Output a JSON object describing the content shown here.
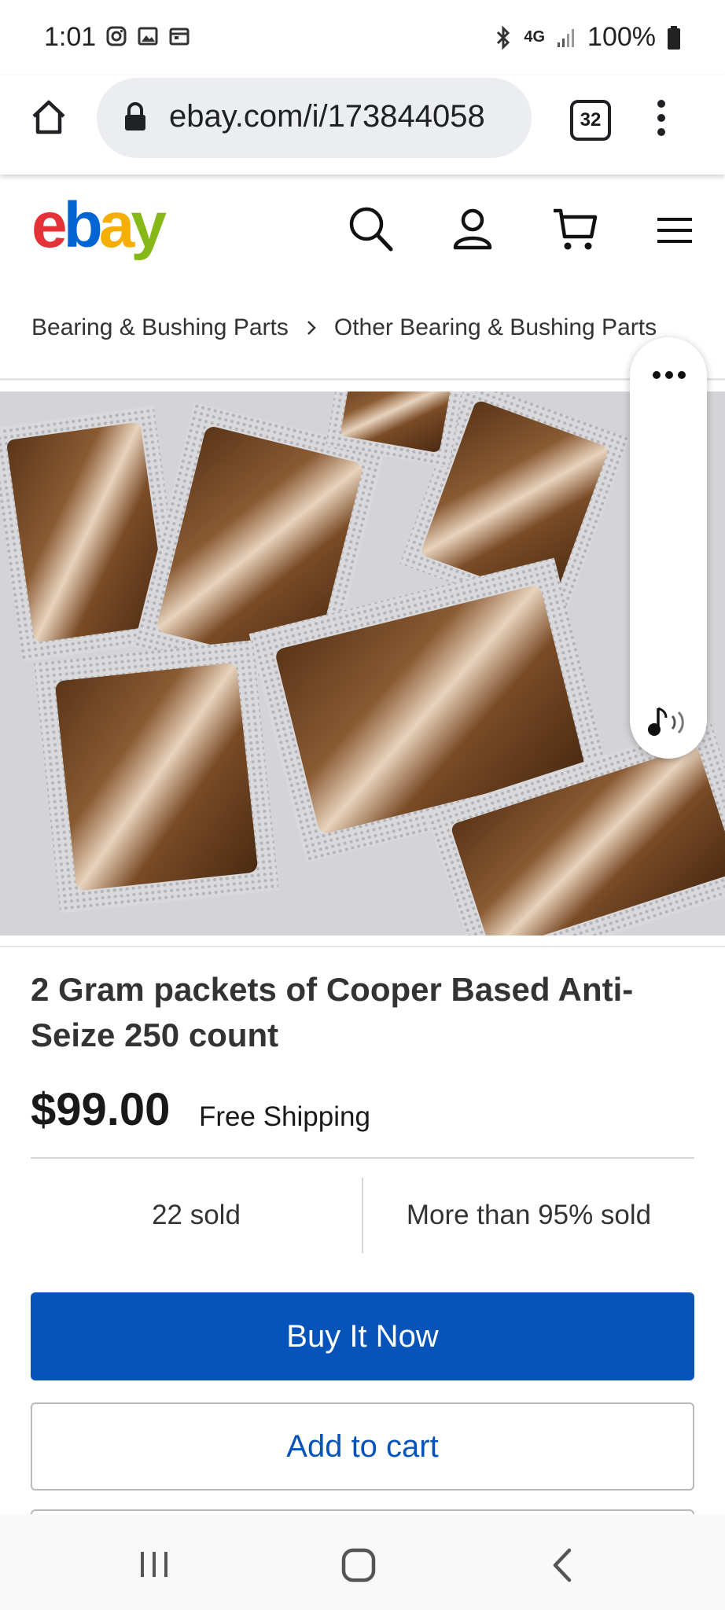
{
  "status_bar": {
    "time": "1:01",
    "network": "4G",
    "battery": "100%",
    "icons": [
      "instagram-icon",
      "gallery-icon",
      "calendar-icon",
      "bluetooth-icon",
      "signal-icon",
      "battery-icon"
    ]
  },
  "browser": {
    "url": "ebay.com/i/173844058",
    "tab_count": "32",
    "icons": [
      "home-icon",
      "lock-icon",
      "tab-switcher-icon",
      "overflow-menu-icon"
    ]
  },
  "header": {
    "logo_letters": [
      "e",
      "b",
      "a",
      "y"
    ],
    "logo_colors": [
      "#e53238",
      "#0064d2",
      "#f5af02",
      "#86b817"
    ],
    "icons": [
      "search-icon",
      "account-icon",
      "cart-icon",
      "hamburger-menu-icon"
    ]
  },
  "breadcrumb": {
    "items": [
      "Bearing & Bushing Parts",
      "Other Bearing & Bushing Parts"
    ]
  },
  "floating_panel": {
    "icons": [
      "more-dots-icon",
      "audio-note-icon"
    ]
  },
  "product": {
    "title": "2 Gram packets of Cooper Based Anti-Seize 250 count",
    "price": "$99.00",
    "shipping": "Free Shipping",
    "sold_count": "22 sold",
    "sold_percent": "More than 95% sold"
  },
  "actions": {
    "buy_now": "Buy It Now",
    "add_to_cart": "Add to cart"
  },
  "colors": {
    "accent_blue": "#0654ba"
  },
  "navbar": {
    "icons": [
      "recent-apps-icon",
      "home-button-icon",
      "back-icon"
    ]
  }
}
